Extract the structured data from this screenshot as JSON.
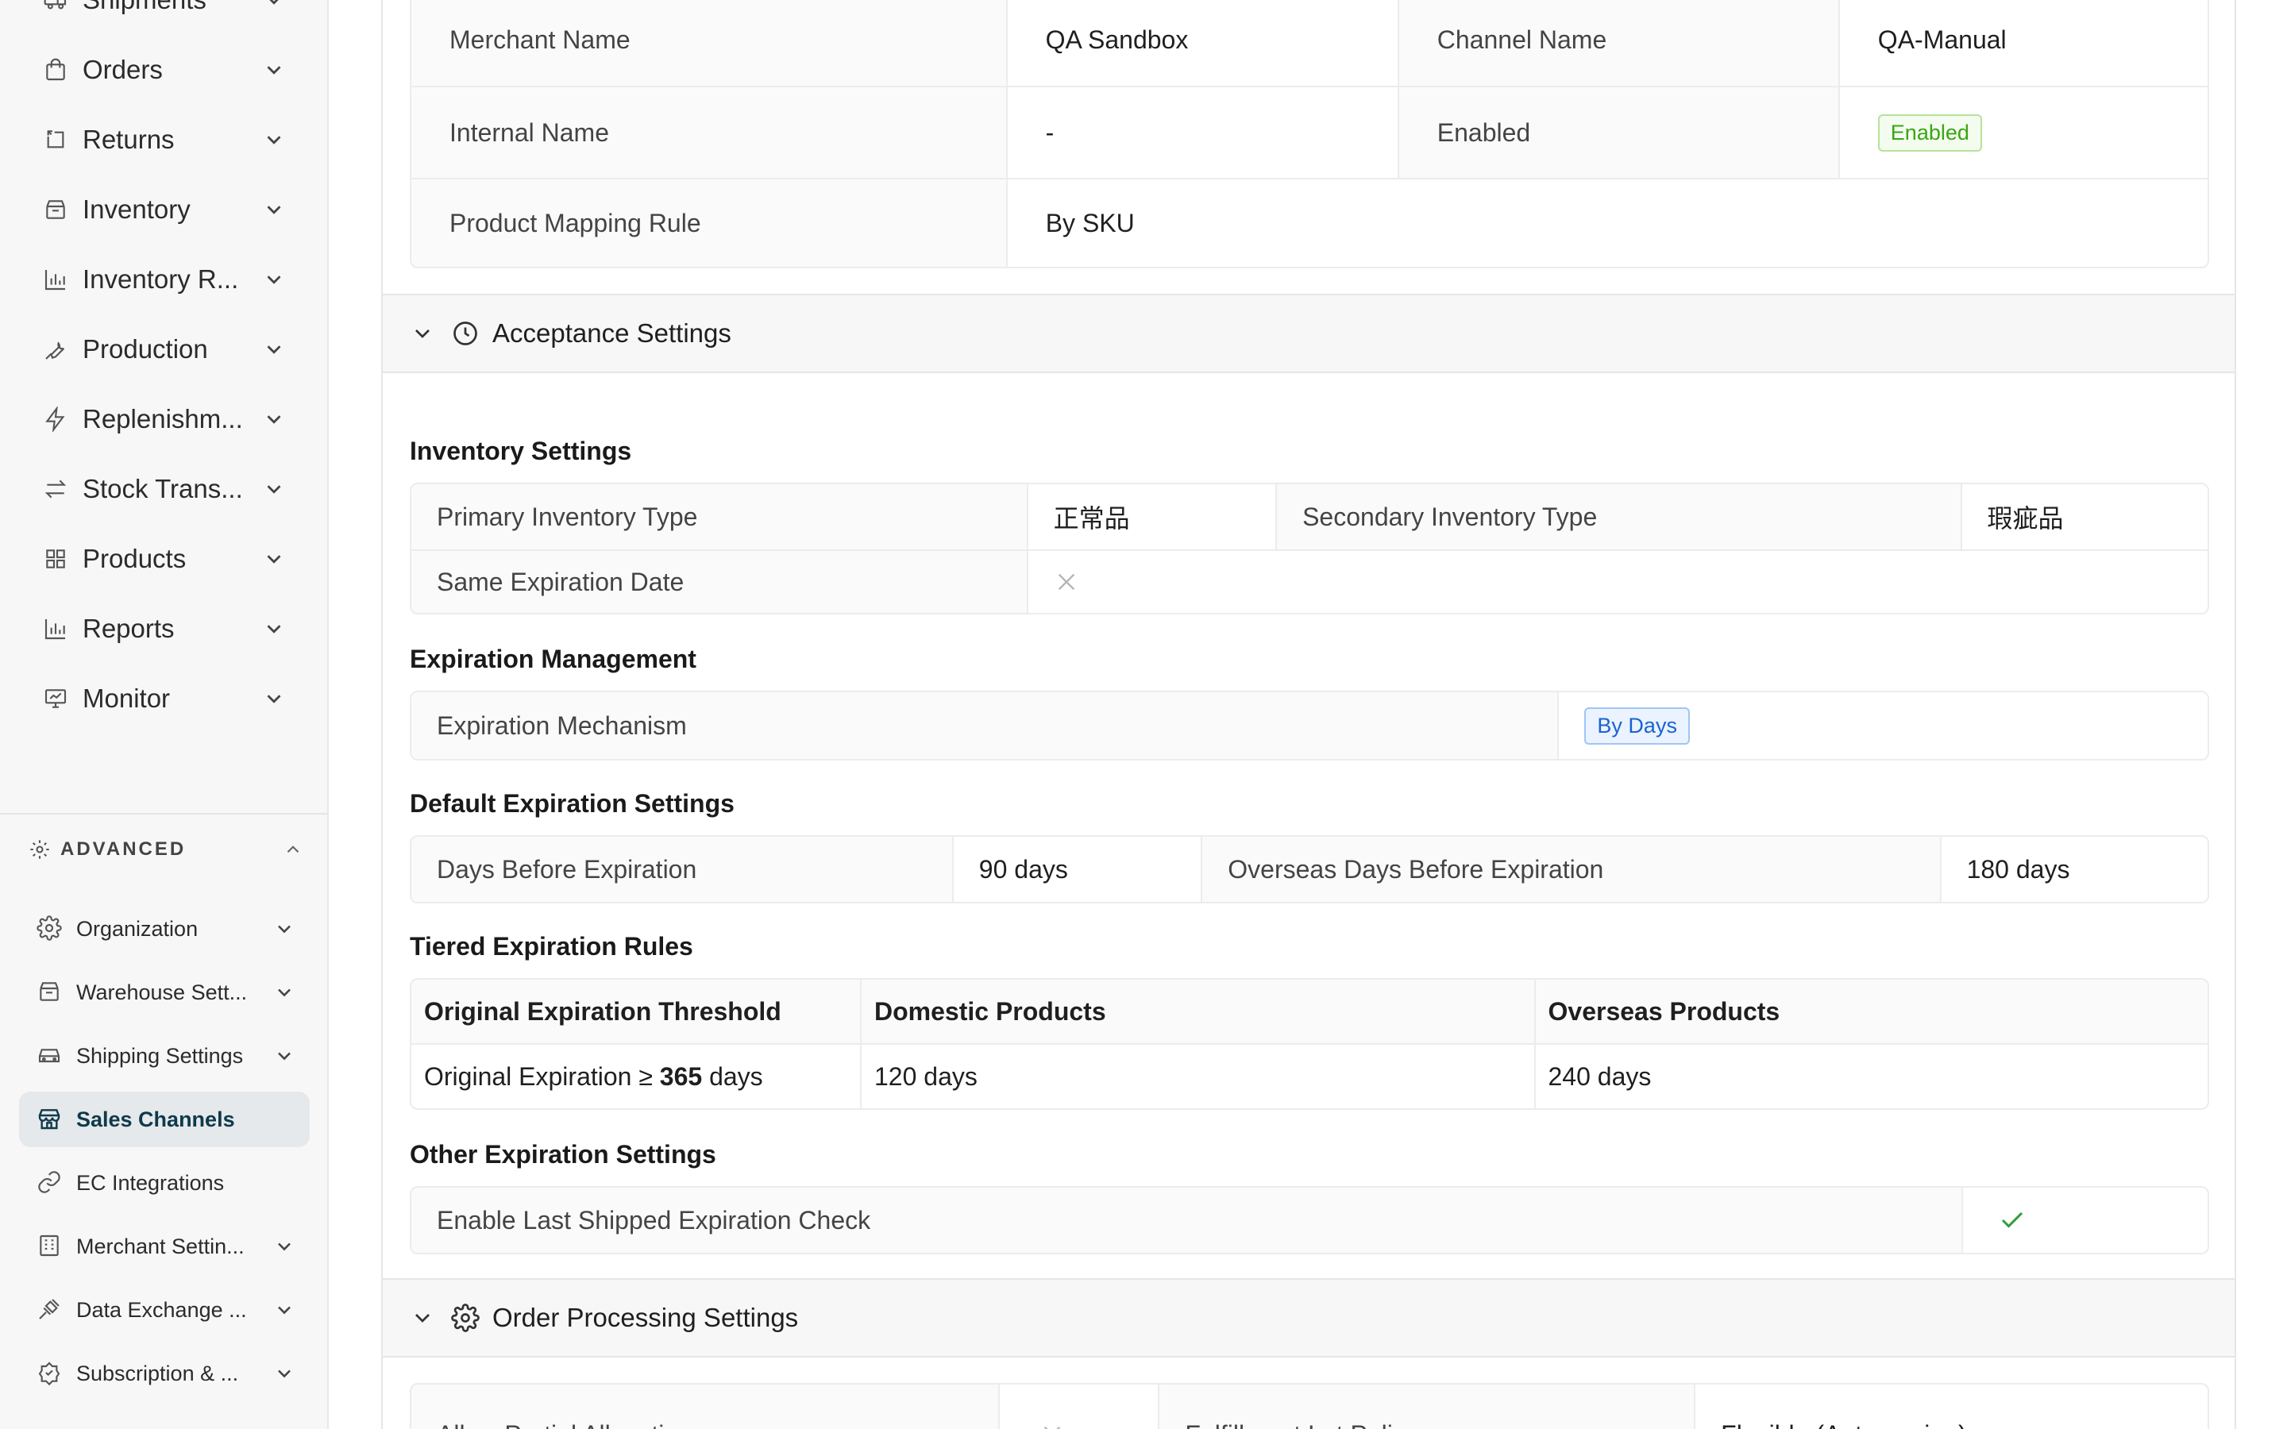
{
  "sidebar": {
    "nav": [
      {
        "id": "shipments",
        "label": "Shipments",
        "icon": "truck-icon"
      },
      {
        "id": "orders",
        "label": "Orders",
        "icon": "shopping-bag-icon"
      },
      {
        "id": "returns",
        "label": "Returns",
        "icon": "return-arrow-icon"
      },
      {
        "id": "inventory",
        "label": "Inventory",
        "icon": "archive-box-icon"
      },
      {
        "id": "inventory-reports",
        "label": "Inventory R...",
        "icon": "bar-chart-icon"
      },
      {
        "id": "production",
        "label": "Production",
        "icon": "wrench-icon"
      },
      {
        "id": "replenishment",
        "label": "Replenishm...",
        "icon": "lightning-icon"
      },
      {
        "id": "stock-transfers",
        "label": "Stock Trans...",
        "icon": "transfer-arrows-icon"
      },
      {
        "id": "products",
        "label": "Products",
        "icon": "grid-icon"
      },
      {
        "id": "reports",
        "label": "Reports",
        "icon": "bar-chart-icon"
      },
      {
        "id": "monitor",
        "label": "Monitor",
        "icon": "monitor-chart-icon"
      }
    ],
    "advanced_label": "ADVANCED",
    "advanced": [
      {
        "id": "organization",
        "label": "Organization",
        "icon": "gear-icon",
        "chevron": true
      },
      {
        "id": "warehouse-settings",
        "label": "Warehouse Sett...",
        "icon": "warehouse-icon",
        "chevron": true
      },
      {
        "id": "shipping-settings",
        "label": "Shipping Settings",
        "icon": "car-icon",
        "chevron": true
      },
      {
        "id": "sales-channels",
        "label": "Sales Channels",
        "icon": "storefront-icon",
        "chevron": false,
        "active": true
      },
      {
        "id": "ec-integrations",
        "label": "EC Integrations",
        "icon": "link-icon",
        "chevron": false
      },
      {
        "id": "merchant-settings",
        "label": "Merchant Settin...",
        "icon": "building-icon",
        "chevron": true
      },
      {
        "id": "data-exchange",
        "label": "Data Exchange ...",
        "icon": "plug-icon",
        "chevron": true
      },
      {
        "id": "subscription",
        "label": "Subscription & ...",
        "icon": "badge-icon",
        "chevron": true
      }
    ]
  },
  "basic": {
    "merchant_name_label": "Merchant Name",
    "merchant_name_value": "QA Sandbox",
    "channel_name_label": "Channel Name",
    "channel_name_value": "QA-Manual",
    "internal_name_label": "Internal Name",
    "internal_name_value": "-",
    "enabled_label": "Enabled",
    "enabled_tag": "Enabled",
    "mapping_rule_label": "Product Mapping Rule",
    "mapping_rule_value": "By SKU"
  },
  "acceptance": {
    "header": "Acceptance Settings",
    "inventory_title": "Inventory Settings",
    "primary_type_label": "Primary Inventory Type",
    "primary_type_value": "正常品",
    "secondary_type_label": "Secondary Inventory Type",
    "secondary_type_value": "瑕疵品",
    "same_exp_label": "Same Expiration Date",
    "exp_mgmt_title": "Expiration Management",
    "exp_mechanism_label": "Expiration Mechanism",
    "exp_mechanism_tag": "By Days",
    "default_exp_title": "Default Expiration Settings",
    "days_before_label": "Days Before Expiration",
    "days_before_value": "90 days",
    "overseas_days_label": "Overseas Days Before Expiration",
    "overseas_days_value": "180 days",
    "tiered_title": "Tiered Expiration Rules",
    "tiered_headers": [
      "Original Expiration Threshold",
      "Domestic Products",
      "Overseas Products"
    ],
    "tiered_row": {
      "prefix": "Original Expiration ≥ ",
      "number": "365",
      "suffix": " days",
      "domestic": "120 days",
      "overseas": "240 days"
    },
    "other_exp_title": "Other Expiration Settings",
    "last_shipped_label": "Enable Last Shipped Expiration Check"
  },
  "order_processing": {
    "header": "Order Processing Settings",
    "partial_alloc_label": "Allow Partial Allocation",
    "lot_policy_label": "Fulfillment Lot Policy",
    "lot_policy_value": "Flexible (Auto-assign)"
  },
  "colors": {
    "accent": "#0f3a4a",
    "success": "#3aa614",
    "info": "#1a63d0",
    "check": "#2e9e3a"
  }
}
